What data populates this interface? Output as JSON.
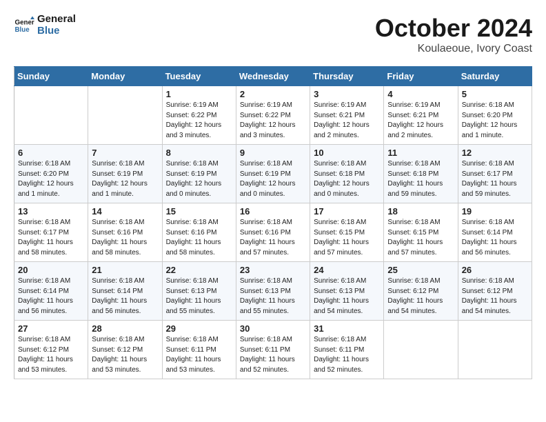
{
  "header": {
    "logo_line1": "General",
    "logo_line2": "Blue",
    "month": "October 2024",
    "location": "Koulaeoue, Ivory Coast"
  },
  "weekdays": [
    "Sunday",
    "Monday",
    "Tuesday",
    "Wednesday",
    "Thursday",
    "Friday",
    "Saturday"
  ],
  "weeks": [
    [
      {
        "day": "",
        "text": ""
      },
      {
        "day": "",
        "text": ""
      },
      {
        "day": "1",
        "text": "Sunrise: 6:19 AM\nSunset: 6:22 PM\nDaylight: 12 hours\nand 3 minutes."
      },
      {
        "day": "2",
        "text": "Sunrise: 6:19 AM\nSunset: 6:22 PM\nDaylight: 12 hours\nand 3 minutes."
      },
      {
        "day": "3",
        "text": "Sunrise: 6:19 AM\nSunset: 6:21 PM\nDaylight: 12 hours\nand 2 minutes."
      },
      {
        "day": "4",
        "text": "Sunrise: 6:19 AM\nSunset: 6:21 PM\nDaylight: 12 hours\nand 2 minutes."
      },
      {
        "day": "5",
        "text": "Sunrise: 6:18 AM\nSunset: 6:20 PM\nDaylight: 12 hours\nand 1 minute."
      }
    ],
    [
      {
        "day": "6",
        "text": "Sunrise: 6:18 AM\nSunset: 6:20 PM\nDaylight: 12 hours\nand 1 minute."
      },
      {
        "day": "7",
        "text": "Sunrise: 6:18 AM\nSunset: 6:19 PM\nDaylight: 12 hours\nand 1 minute."
      },
      {
        "day": "8",
        "text": "Sunrise: 6:18 AM\nSunset: 6:19 PM\nDaylight: 12 hours\nand 0 minutes."
      },
      {
        "day": "9",
        "text": "Sunrise: 6:18 AM\nSunset: 6:19 PM\nDaylight: 12 hours\nand 0 minutes."
      },
      {
        "day": "10",
        "text": "Sunrise: 6:18 AM\nSunset: 6:18 PM\nDaylight: 12 hours\nand 0 minutes."
      },
      {
        "day": "11",
        "text": "Sunrise: 6:18 AM\nSunset: 6:18 PM\nDaylight: 11 hours\nand 59 minutes."
      },
      {
        "day": "12",
        "text": "Sunrise: 6:18 AM\nSunset: 6:17 PM\nDaylight: 11 hours\nand 59 minutes."
      }
    ],
    [
      {
        "day": "13",
        "text": "Sunrise: 6:18 AM\nSunset: 6:17 PM\nDaylight: 11 hours\nand 58 minutes."
      },
      {
        "day": "14",
        "text": "Sunrise: 6:18 AM\nSunset: 6:16 PM\nDaylight: 11 hours\nand 58 minutes."
      },
      {
        "day": "15",
        "text": "Sunrise: 6:18 AM\nSunset: 6:16 PM\nDaylight: 11 hours\nand 58 minutes."
      },
      {
        "day": "16",
        "text": "Sunrise: 6:18 AM\nSunset: 6:16 PM\nDaylight: 11 hours\nand 57 minutes."
      },
      {
        "day": "17",
        "text": "Sunrise: 6:18 AM\nSunset: 6:15 PM\nDaylight: 11 hours\nand 57 minutes."
      },
      {
        "day": "18",
        "text": "Sunrise: 6:18 AM\nSunset: 6:15 PM\nDaylight: 11 hours\nand 57 minutes."
      },
      {
        "day": "19",
        "text": "Sunrise: 6:18 AM\nSunset: 6:14 PM\nDaylight: 11 hours\nand 56 minutes."
      }
    ],
    [
      {
        "day": "20",
        "text": "Sunrise: 6:18 AM\nSunset: 6:14 PM\nDaylight: 11 hours\nand 56 minutes."
      },
      {
        "day": "21",
        "text": "Sunrise: 6:18 AM\nSunset: 6:14 PM\nDaylight: 11 hours\nand 56 minutes."
      },
      {
        "day": "22",
        "text": "Sunrise: 6:18 AM\nSunset: 6:13 PM\nDaylight: 11 hours\nand 55 minutes."
      },
      {
        "day": "23",
        "text": "Sunrise: 6:18 AM\nSunset: 6:13 PM\nDaylight: 11 hours\nand 55 minutes."
      },
      {
        "day": "24",
        "text": "Sunrise: 6:18 AM\nSunset: 6:13 PM\nDaylight: 11 hours\nand 54 minutes."
      },
      {
        "day": "25",
        "text": "Sunrise: 6:18 AM\nSunset: 6:12 PM\nDaylight: 11 hours\nand 54 minutes."
      },
      {
        "day": "26",
        "text": "Sunrise: 6:18 AM\nSunset: 6:12 PM\nDaylight: 11 hours\nand 54 minutes."
      }
    ],
    [
      {
        "day": "27",
        "text": "Sunrise: 6:18 AM\nSunset: 6:12 PM\nDaylight: 11 hours\nand 53 minutes."
      },
      {
        "day": "28",
        "text": "Sunrise: 6:18 AM\nSunset: 6:12 PM\nDaylight: 11 hours\nand 53 minutes."
      },
      {
        "day": "29",
        "text": "Sunrise: 6:18 AM\nSunset: 6:11 PM\nDaylight: 11 hours\nand 53 minutes."
      },
      {
        "day": "30",
        "text": "Sunrise: 6:18 AM\nSunset: 6:11 PM\nDaylight: 11 hours\nand 52 minutes."
      },
      {
        "day": "31",
        "text": "Sunrise: 6:18 AM\nSunset: 6:11 PM\nDaylight: 11 hours\nand 52 minutes."
      },
      {
        "day": "",
        "text": ""
      },
      {
        "day": "",
        "text": ""
      }
    ]
  ]
}
